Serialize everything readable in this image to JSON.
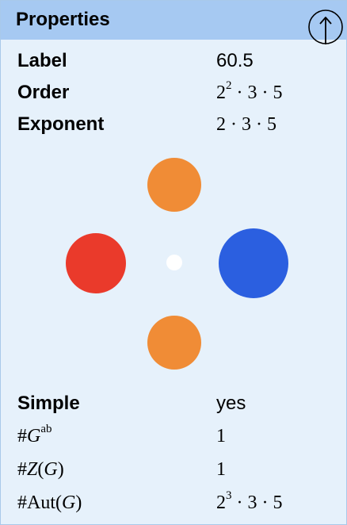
{
  "header": {
    "title": "Properties",
    "collapse_icon": "circled-up-arrow-icon"
  },
  "properties_top": [
    {
      "key": "Label",
      "value_text": "60.5"
    },
    {
      "key": "Order",
      "value_parts": {
        "base": "2",
        "exp": "2",
        "rest": " · 3 · 5"
      }
    },
    {
      "key": "Exponent",
      "value_text": "2 · 3 · 5"
    }
  ],
  "diagram": {
    "nodes": [
      {
        "color": "#f08c36"
      },
      {
        "color": "#ea3a2b"
      },
      {
        "color": "#ffffff"
      },
      {
        "color": "#2b5fe0"
      },
      {
        "color": "#f08c36"
      }
    ]
  },
  "properties_bottom": {
    "simple": {
      "key": "Simple",
      "value": "yes"
    },
    "abelianization": {
      "prefix": "#",
      "sym": "G",
      "sup": "ab",
      "value": "1"
    },
    "center": {
      "prefix": "#",
      "sym": "Z",
      "open": "(",
      "arg": "G",
      "close": ")",
      "value": "1"
    },
    "automorphisms": {
      "prefix": "#",
      "name": "Aut",
      "open": "(",
      "arg": "G",
      "close": ")",
      "value_base": "2",
      "value_exp": "3",
      "value_rest": " · 3 · 5"
    }
  }
}
